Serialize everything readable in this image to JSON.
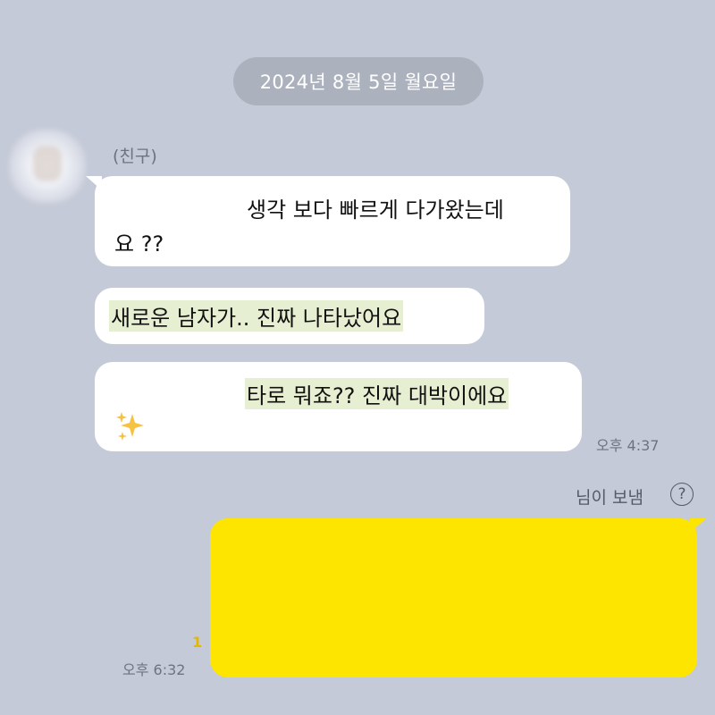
{
  "date_divider": "2024년 8월 5일 월요일",
  "received": {
    "sender_name": "(친구)",
    "messages": [
      {
        "lines": [
          "생각 보다 빠르게 다가왔는데",
          "요 ??"
        ]
      },
      {
        "lines": [
          "새로운 남자가..  진짜 나타났어요"
        ]
      },
      {
        "lines": [
          "타로 뭐죠??  진짜 대박이에요"
        ],
        "emoji": "sparkles-icon"
      }
    ],
    "time": "오후 4:37"
  },
  "sent": {
    "sender_note": "님이 보냄",
    "help_symbol": "?",
    "unread_count": "1",
    "time": "오후 6:32"
  },
  "colors": {
    "background": "#c5cad8",
    "received_bubble": "#ffffff",
    "sent_bubble": "#fee500",
    "highlight": "#e7efd2",
    "unread": "#e4b700"
  }
}
